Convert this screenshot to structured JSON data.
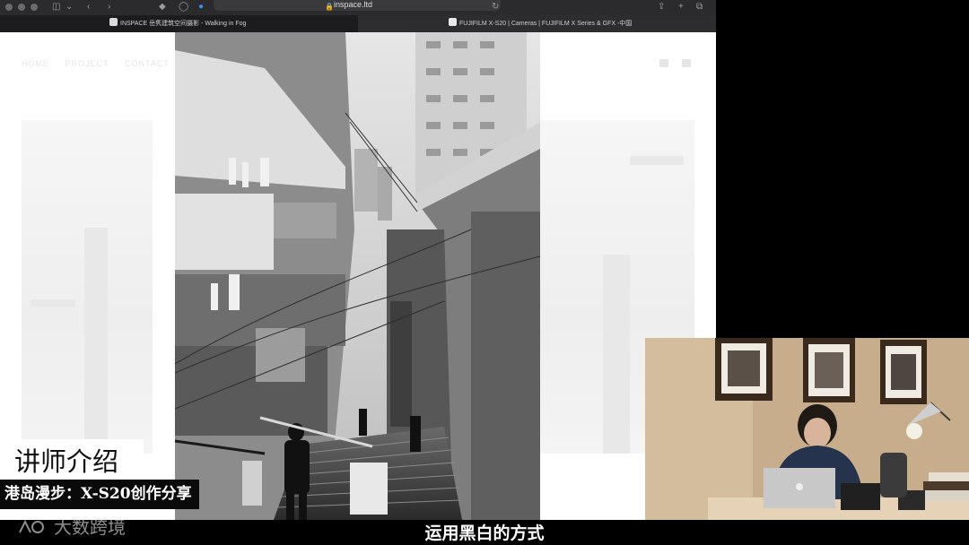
{
  "browser": {
    "url": "inspace.ltd",
    "tabs": [
      {
        "label": "INSPACE 岳隽建筑空间摄影 - Walking in Fog",
        "active": false
      },
      {
        "label": "FUJIFILM X-S20 | Cameras | FUJIFILM X Series & GFX -中国",
        "active": true
      }
    ]
  },
  "site": {
    "nav": [
      "HOME",
      "PROJECT",
      "CONTACT"
    ]
  },
  "overlay": {
    "title": "讲师介绍",
    "subtitle": "港岛漫步：X-S20创作分享"
  },
  "caption": "运用黑白的方式",
  "watermark": "大数跨境",
  "colors": {
    "chrome_dark": "#2b2b2d",
    "tab_bar": "#1c1c1e",
    "cam_wall": "#c9b190"
  },
  "icons": {
    "sidebar": "sidebar-icon",
    "back": "back-arrow-icon",
    "forward": "forward-arrow-icon",
    "shield": "shield-icon",
    "lock": "lock-icon",
    "reload": "reload-icon",
    "share": "share-icon",
    "new_tab": "plus-icon",
    "tab_overview": "tabs-overview-icon"
  }
}
